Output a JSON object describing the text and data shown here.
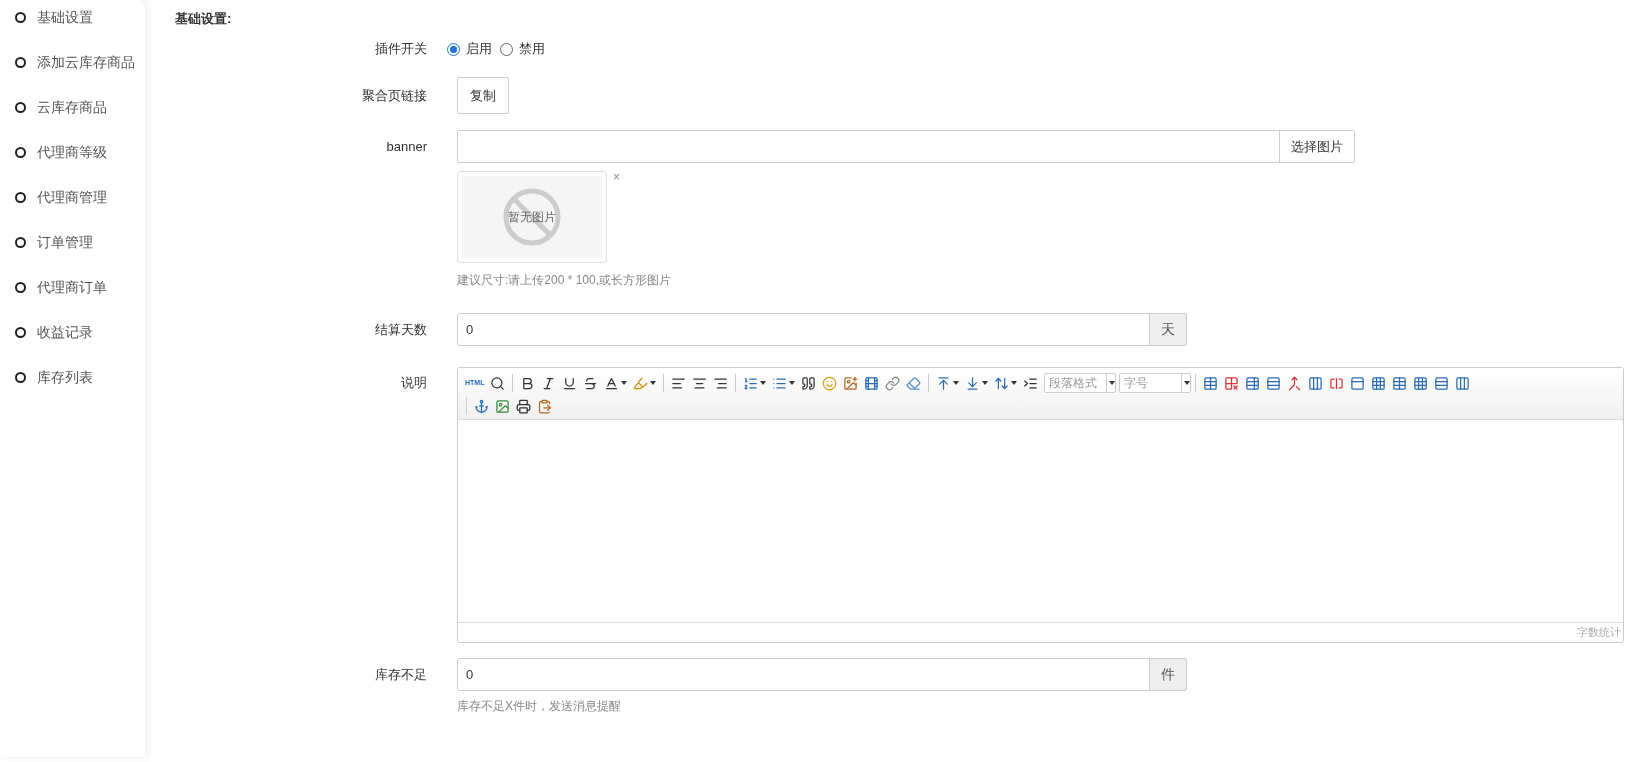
{
  "sidebar": {
    "items": [
      {
        "label": "基础设置",
        "selected": false
      },
      {
        "label": "添加云库存商品",
        "selected": false
      },
      {
        "label": "云库存商品",
        "selected": false
      },
      {
        "label": "代理商等级",
        "selected": false
      },
      {
        "label": "代理商管理",
        "selected": false
      },
      {
        "label": "订单管理",
        "selected": false
      },
      {
        "label": "代理商订单",
        "selected": false
      },
      {
        "label": "收益记录",
        "selected": false
      },
      {
        "label": "库存列表",
        "selected": false
      }
    ]
  },
  "section_title": "基础设置:",
  "plugin_switch": {
    "label": "插件开关",
    "options": [
      {
        "label": "启用",
        "selected": true
      },
      {
        "label": "禁用",
        "selected": false
      }
    ]
  },
  "page_link": {
    "label": "聚合页链接",
    "button": "复制"
  },
  "banner": {
    "label": "banner",
    "button": "选择图片",
    "preview_text": "暂无图片",
    "remove": "×",
    "hint": "建议尺寸:请上传200 * 100,或长方形图片"
  },
  "settle_days": {
    "label": "结算天数",
    "value": "0",
    "unit": "天"
  },
  "description": {
    "label": "说明",
    "editor": {
      "html_label": "HTML",
      "paragraph_select": "段落格式",
      "font_size_select": "字号",
      "status": "字数统计"
    }
  },
  "low_stock": {
    "label": "库存不足",
    "value": "0",
    "unit": "件",
    "hint": "库存不足X件时，发送消息提醒"
  }
}
